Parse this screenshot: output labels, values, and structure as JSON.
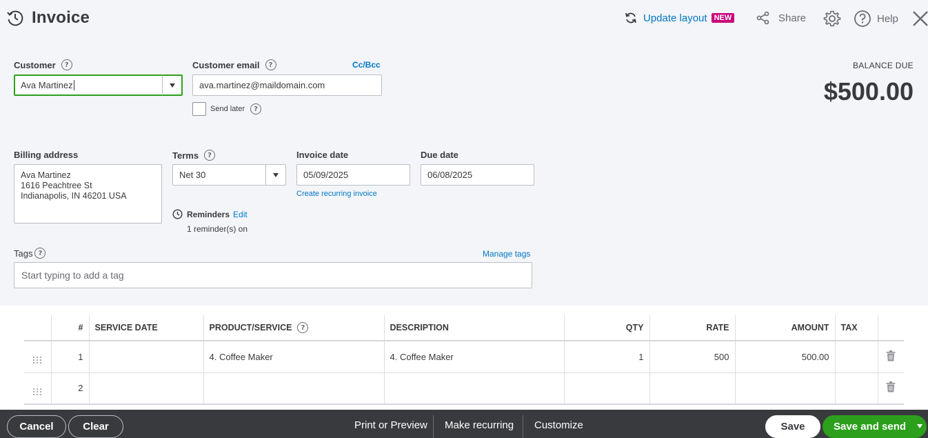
{
  "header": {
    "title": "Invoice",
    "update_layout": "Update layout",
    "new_badge": "NEW",
    "share": "Share",
    "help": "Help"
  },
  "customer": {
    "label": "Customer",
    "value": "Ava Martinez"
  },
  "email": {
    "label": "Customer email",
    "cc_bcc": "Cc/Bcc",
    "value": "ava.martinez@maildomain.com",
    "send_later": "Send later"
  },
  "balance": {
    "label": "BALANCE DUE",
    "value": "$500.00"
  },
  "billing": {
    "label": "Billing address",
    "lines": [
      "Ava Martinez",
      "1616 Peachtree St",
      "Indianapolis, IN  46201 USA"
    ]
  },
  "terms": {
    "label": "Terms",
    "value": "Net 30"
  },
  "invoice_date": {
    "label": "Invoice date",
    "value": "05/09/2025",
    "recurring_link": "Create recurring invoice"
  },
  "due_date": {
    "label": "Due date",
    "value": "06/08/2025"
  },
  "reminders": {
    "label": "Reminders",
    "edit": "Edit",
    "status": "1 reminder(s) on"
  },
  "tags": {
    "label": "Tags",
    "manage": "Manage tags",
    "placeholder": "Start typing to add a tag"
  },
  "table": {
    "headers": [
      "#",
      "SERVICE DATE",
      "PRODUCT/SERVICE",
      "DESCRIPTION",
      "QTY",
      "RATE",
      "AMOUNT",
      "TAX"
    ],
    "rows": [
      {
        "num": "1",
        "service_date": "",
        "product": "4. Coffee Maker",
        "description": "4. Coffee Maker",
        "qty": "1",
        "rate": "500",
        "amount": "500.00",
        "tax": ""
      },
      {
        "num": "2",
        "service_date": "",
        "product": "",
        "description": "",
        "qty": "",
        "rate": "",
        "amount": "",
        "tax": ""
      }
    ]
  },
  "footer": {
    "cancel": "Cancel",
    "clear": "Clear",
    "print_preview": "Print or Preview",
    "make_recurring": "Make recurring",
    "customize": "Customize",
    "save": "Save",
    "save_and_send": "Save and send"
  },
  "colors": {
    "accent_green": "#2ca01c",
    "link_blue": "#0077c5",
    "new_badge": "#c9007a",
    "footer_bg": "#393a3d"
  }
}
